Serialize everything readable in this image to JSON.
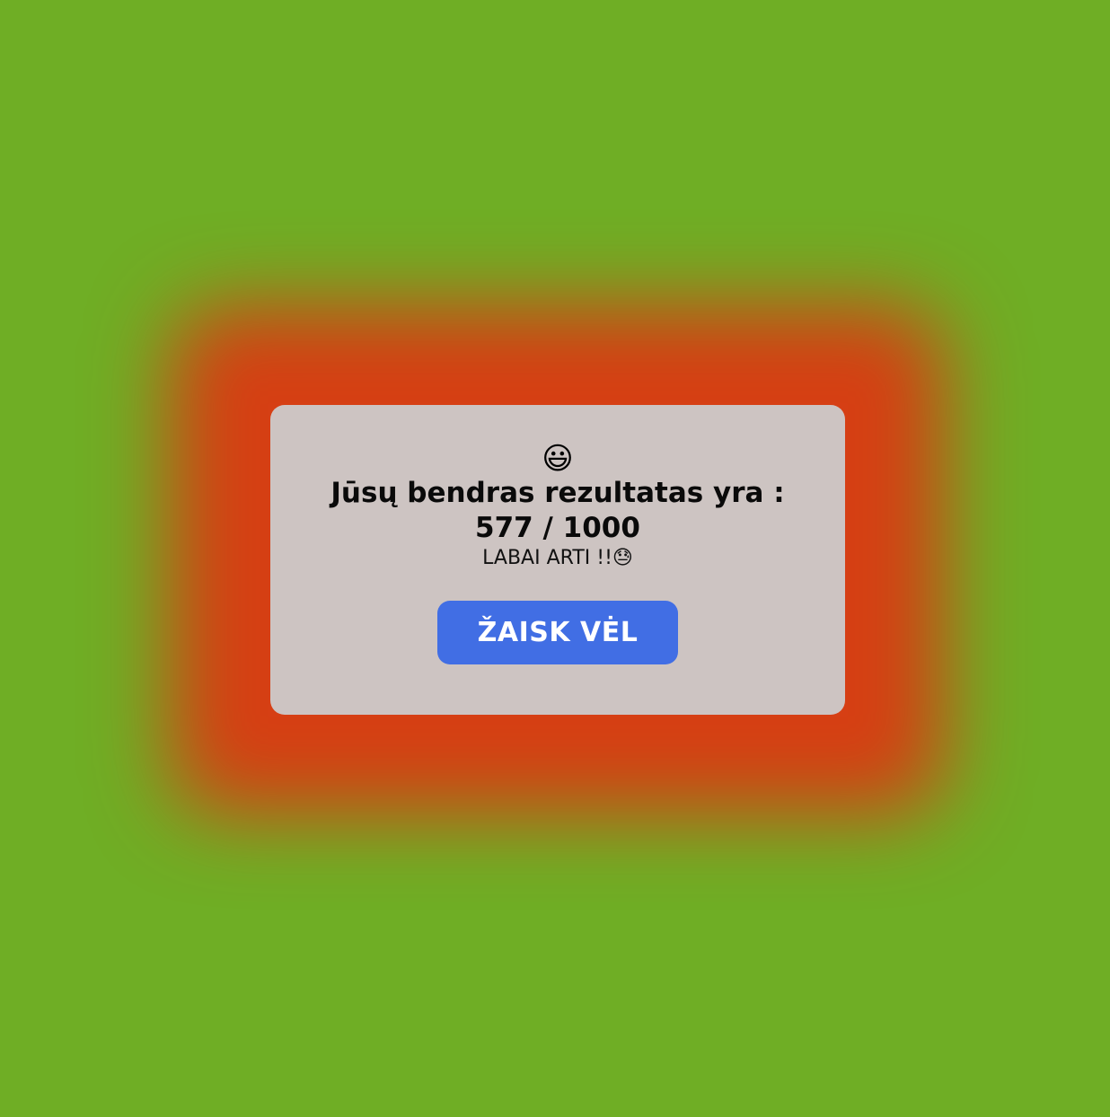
{
  "result_modal": {
    "top_emoji": "😃",
    "score_text": "Jūsų bendras rezultatas yra : 577 / 1000",
    "subtitle_text": "LABAI ARTI !!",
    "subtitle_icon": "😓",
    "play_again_label": "ŽAISK VĖL"
  },
  "colors": {
    "background": "#6fae25",
    "glow": "#d63f14",
    "modal": "#cdc4c2",
    "button": "#416ee4"
  }
}
